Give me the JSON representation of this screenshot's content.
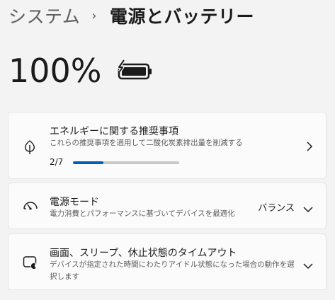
{
  "breadcrumb": {
    "parent": "システム",
    "separator": "›",
    "current": "電源とバッテリー"
  },
  "battery": {
    "percent_label": "100%",
    "icon": "battery-charging-icon",
    "level": 1.0
  },
  "cards": [
    {
      "icon": "leaf-icon",
      "title": "エネルギーに関する推奨事項",
      "description": "これらの推奨事項を適用して二酸化炭素排出量を削減する",
      "progress_label": "2/7",
      "progress": 0.2857,
      "action_icon": "chevron-right-icon"
    },
    {
      "icon": "power-mode-gauge-icon",
      "title": "電源モード",
      "description": "電力消費とパフォーマンスに基づいてデバイスを最適化",
      "value": "バランス",
      "action_icon": "chevron-down-icon"
    },
    {
      "icon": "screen-sleep-icon",
      "title": "画面、スリープ、休止状態のタイムアウト",
      "description_line1": "デバイスが指定された時間にわたりアイドル状態になった場合の動作を選",
      "description_line2": "択します",
      "action_icon": "chevron-down-icon"
    }
  ],
  "colors": {
    "accent": "#005fb8",
    "background": "#f3f3f3",
    "card": "#fbfbfb"
  }
}
